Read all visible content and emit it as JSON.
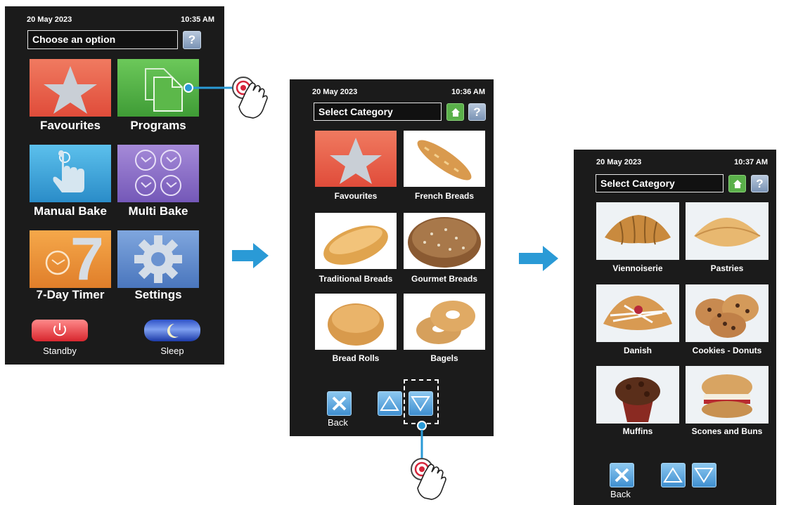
{
  "screen1": {
    "date": "20 May 2023",
    "time": "10:35 AM",
    "title": "Choose an option",
    "help": "?",
    "tiles": [
      {
        "label": "Favourites"
      },
      {
        "label": "Programs"
      },
      {
        "label": "Manual Bake"
      },
      {
        "label": "Multi Bake"
      },
      {
        "label": "7-Day Timer",
        "glyph": "7"
      },
      {
        "label": "Settings"
      }
    ],
    "standby_label": "Standby",
    "sleep_label": "Sleep"
  },
  "screen2": {
    "date": "20 May 2023",
    "time": "10:36 AM",
    "title": "Select Category",
    "help": "?",
    "categories": [
      {
        "label": "Favourites"
      },
      {
        "label": "French Breads"
      },
      {
        "label": "Traditional Breads"
      },
      {
        "label": "Gourmet Breads"
      },
      {
        "label": "Bread Rolls"
      },
      {
        "label": "Bagels"
      }
    ],
    "back_label": "Back"
  },
  "screen3": {
    "date": "20 May 2023",
    "time": "10:37 AM",
    "title": "Select Category",
    "help": "?",
    "categories": [
      {
        "label": "Viennoiserie"
      },
      {
        "label": "Pastries"
      },
      {
        "label": "Danish"
      },
      {
        "label": "Cookies - Donuts"
      },
      {
        "label": "Muffins"
      },
      {
        "label": "Scones and Buns"
      }
    ],
    "back_label": "Back"
  },
  "colors": {
    "accent_blue": "#3a9ad9",
    "favourites_red": "#e8604c",
    "programs_green": "#5cb84a",
    "manual_blue": "#3aa4d8",
    "multi_purple": "#8a6ec9",
    "timer_orange": "#f0953a",
    "settings_blue": "#5a86c9"
  }
}
